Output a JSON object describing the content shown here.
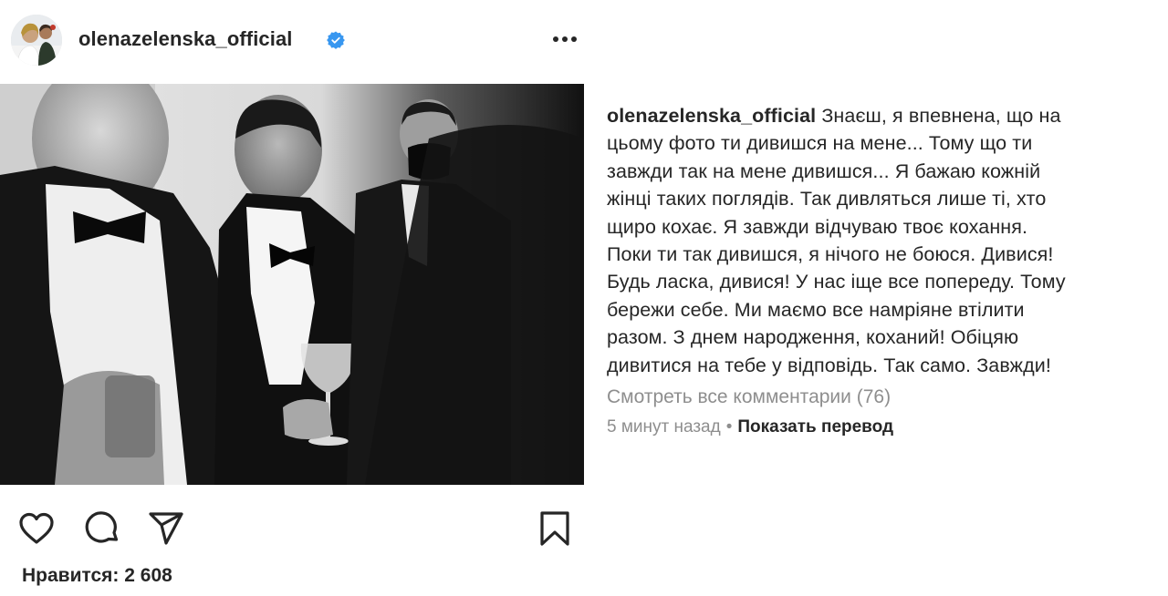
{
  "post": {
    "username": "olenazelenska_official",
    "verified": true,
    "more_icon": "ellipsis-icon"
  },
  "photo": {
    "style": "black-and-white",
    "alt_icon": "photo"
  },
  "actions": {
    "like_icon": "heart-icon",
    "comment_icon": "comment-icon",
    "share_icon": "share-icon",
    "save_icon": "bookmark-icon"
  },
  "likes": {
    "text": "Нравится: 2 608"
  },
  "caption": {
    "username": "olenazelenska_official",
    "text": " Знаєш, я впевнена, що на\nцьому фото ти дивишся на мене... Тому що ти\nзавжди так на мене дивишся... Я бажаю кожній\nжінці таких поглядів. Так дивляться лише ті, хто\nщиро кохає. Я завжди відчуваю твоє кохання.\nПоки ти так дивишся, я нічого не боюся. Дивися!\nБудь ласка, дивися! У нас іще все попереду. Тому\nбережи себе. Ми маємо все намріяне втілити\nразом. З днем народження, коханий! Обіцяю\nдивитися на тебе у відповідь. Так само. Завжди!"
  },
  "comments": {
    "view_all": "Смотреть все комментарии (76)"
  },
  "meta": {
    "time": "5 минут назад",
    "separator": "•",
    "translate": "Показать перевод"
  },
  "colors": {
    "text": "#262626",
    "secondary": "#8e8e8e",
    "verified_blue": "#3897f0",
    "background": "#ffffff"
  }
}
